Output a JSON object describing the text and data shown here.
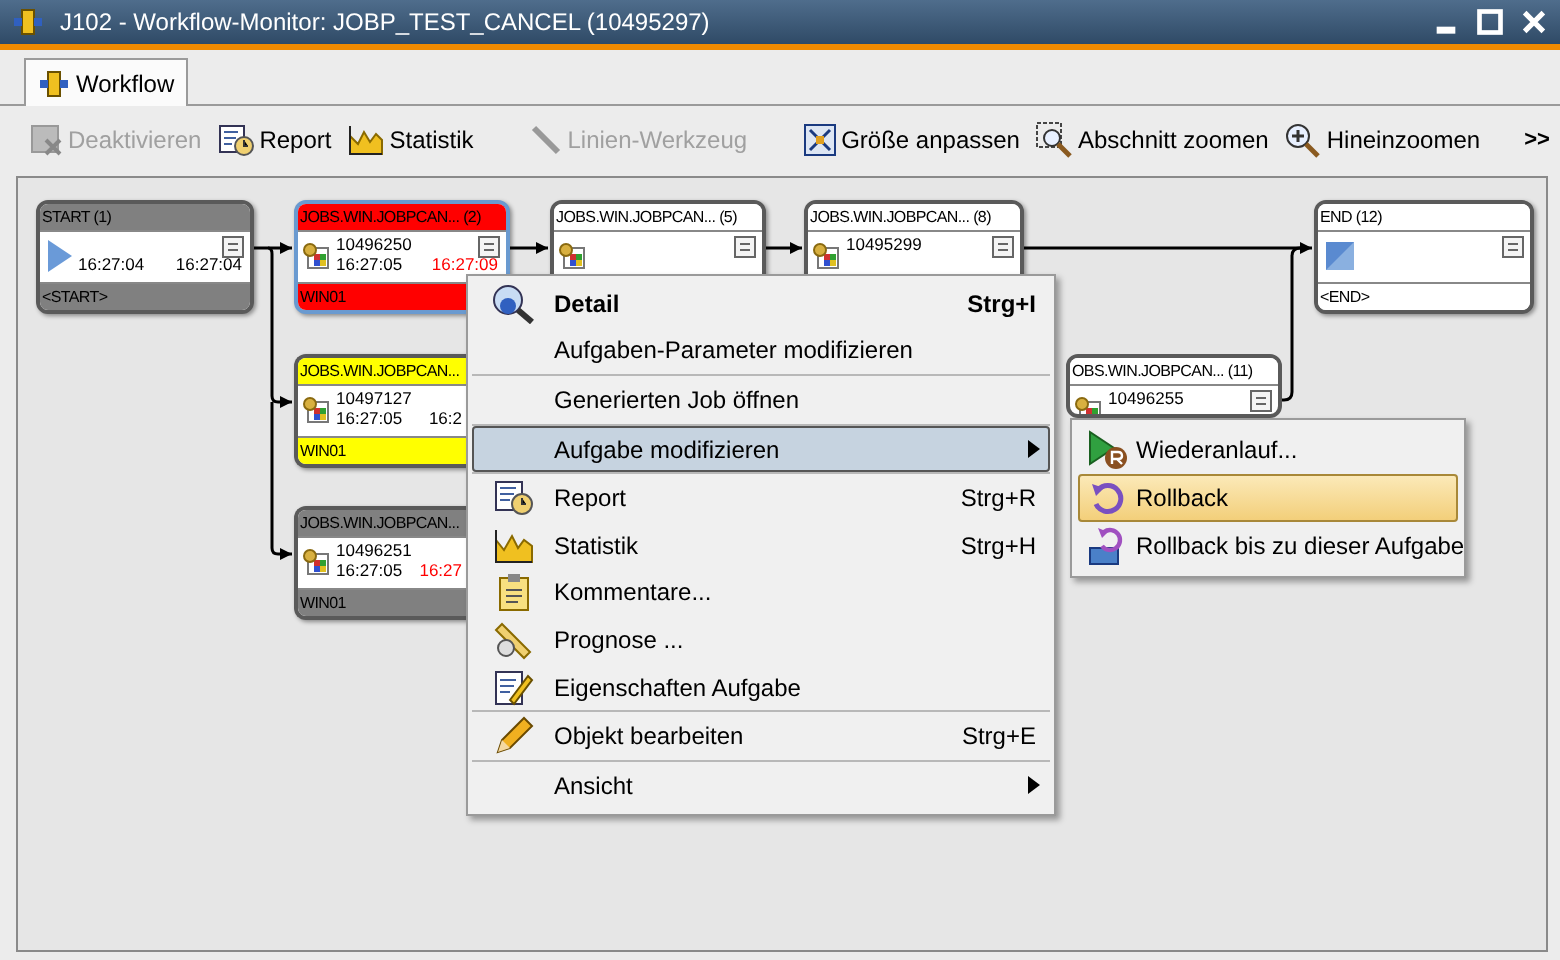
{
  "window": {
    "title": "J102 - Workflow-Monitor: JOBP_TEST_CANCEL (10495297)"
  },
  "tabs": [
    {
      "label": "Workflow",
      "selected": true
    }
  ],
  "toolbar": [
    {
      "label": "Deaktivieren",
      "disabled": true
    },
    {
      "label": "Report",
      "disabled": false
    },
    {
      "label": "Statistik",
      "disabled": false
    },
    {
      "label": "Linien-Werkzeug",
      "disabled": true
    },
    {
      "label": "Größe anpassen",
      "disabled": false
    },
    {
      "label": "Abschnitt zoomen",
      "disabled": false
    },
    {
      "label": "Hineinzoomen",
      "disabled": false
    }
  ],
  "toolbar_overflow": ">>",
  "nodes": [
    {
      "kind": "start",
      "header": "START (1)",
      "color": "#808080",
      "start_time": "16:27:04",
      "end_time": "16:27:04",
      "overdue": false,
      "footer": "<START>",
      "selected": false
    },
    {
      "kind": "job",
      "header": "JOBS.WIN.JOBPCAN... (2)",
      "color": "#ff0000",
      "job_id": "10496250",
      "start_time": "16:27:05",
      "end_time": "16:27:09",
      "overdue": true,
      "footer": "WIN01",
      "selected": true
    },
    {
      "kind": "job",
      "header": "JOBS.WIN.JOBPCAN... (5)",
      "color": "#ffffff",
      "selected": false
    },
    {
      "kind": "job",
      "header": "JOBS.WIN.JOBPCAN... (8)",
      "color": "#ffffff",
      "job_id": "10495299",
      "selected": false
    },
    {
      "kind": "end",
      "header": "END (12)",
      "color": "#ffffff",
      "footer": "<END>",
      "selected": false
    },
    {
      "kind": "job",
      "header": "JOBS.WIN.JOBPCAN...",
      "color": "#ffff00",
      "job_id": "10497127",
      "start_time": "16:27:05",
      "end_time": "16:2",
      "overdue": false,
      "footer": "WIN01",
      "selected": false
    },
    {
      "kind": "job",
      "header": "JOBS.WIN.JOBPCAN...",
      "color": "#808080",
      "job_id": "10496251",
      "start_time": "16:27:05",
      "end_time": "16:27",
      "overdue": true,
      "footer": "WIN01",
      "selected": false
    },
    {
      "kind": "job",
      "header": "OBS.WIN.JOBPCAN... (11)",
      "color": "#ffffff",
      "job_id": "10496255",
      "selected": false
    }
  ],
  "context_menu": [
    {
      "kind": "item",
      "label": "Detail",
      "shortcut": "Strg+I",
      "default": true,
      "selected": false,
      "submenu": false
    },
    {
      "kind": "item",
      "label": "Aufgaben-Parameter modifizieren",
      "default": false,
      "selected": false,
      "submenu": false
    },
    {
      "kind": "separator"
    },
    {
      "kind": "item",
      "label": "Generierten Job öffnen",
      "default": false,
      "selected": false,
      "submenu": false
    },
    {
      "kind": "separator"
    },
    {
      "kind": "item",
      "label": "Aufgabe modifizieren",
      "default": false,
      "selected": true,
      "submenu": true
    },
    {
      "kind": "separator"
    },
    {
      "kind": "item",
      "label": "Report",
      "shortcut": "Strg+R",
      "default": false,
      "selected": false,
      "submenu": false
    },
    {
      "kind": "item",
      "label": "Statistik",
      "shortcut": "Strg+H",
      "default": false,
      "selected": false,
      "submenu": false
    },
    {
      "kind": "item",
      "label": "Kommentare...",
      "default": false,
      "selected": false,
      "submenu": false
    },
    {
      "kind": "item",
      "label": "Prognose ...",
      "default": false,
      "selected": false,
      "submenu": false
    },
    {
      "kind": "item",
      "label": "Eigenschaften Aufgabe",
      "default": false,
      "selected": false,
      "submenu": false
    },
    {
      "kind": "separator"
    },
    {
      "kind": "item",
      "label": "Objekt bearbeiten",
      "shortcut": "Strg+E",
      "default": false,
      "selected": false,
      "submenu": false
    },
    {
      "kind": "separator"
    },
    {
      "kind": "item",
      "label": "Ansicht",
      "default": false,
      "selected": false,
      "submenu": true
    }
  ],
  "submenu": [
    {
      "label": "Wiederanlauf...",
      "selected": false
    },
    {
      "label": "Rollback",
      "selected": true
    },
    {
      "label": "Rollback bis zu dieser Aufgabe",
      "selected": false
    }
  ]
}
